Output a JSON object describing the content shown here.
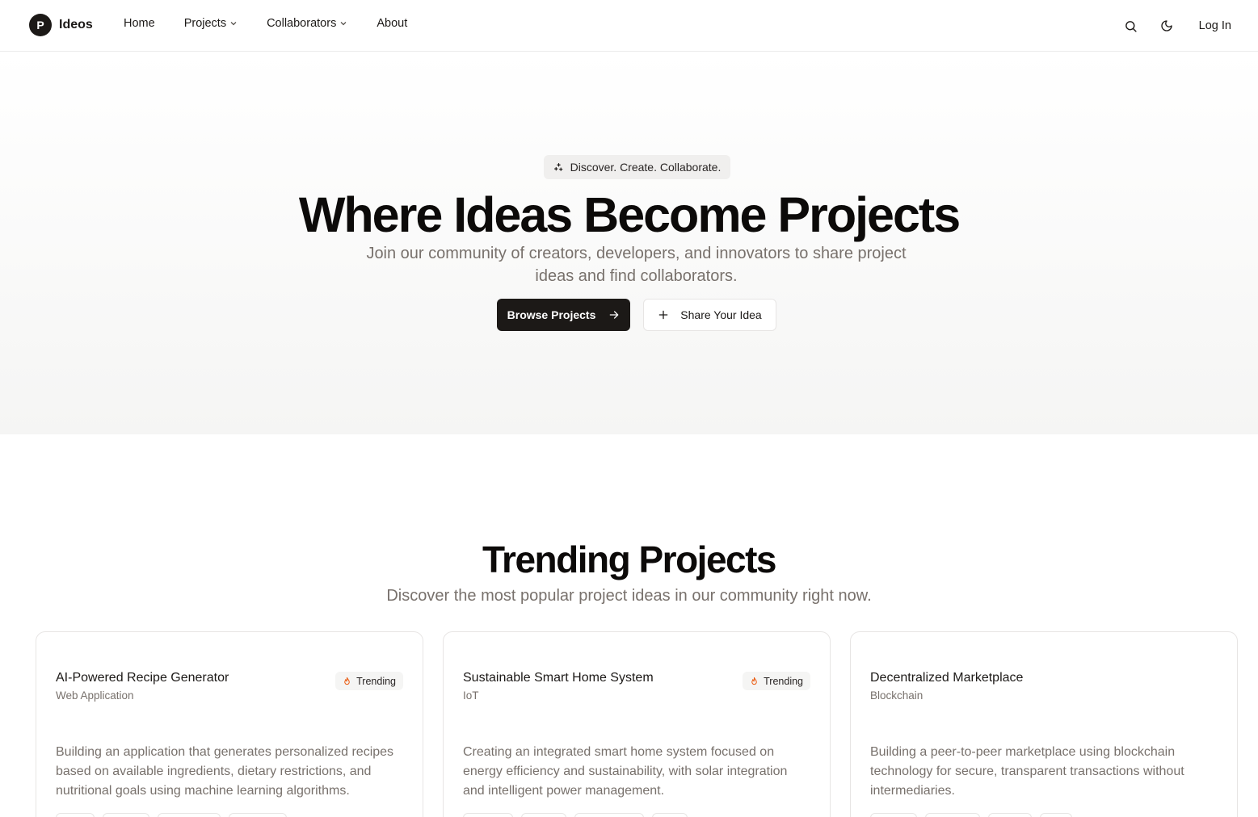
{
  "header": {
    "logo_letter": "P",
    "brand": "Ideos",
    "nav": [
      {
        "label": "Home"
      },
      {
        "label": "Projects"
      },
      {
        "label": "Collaborators"
      },
      {
        "label": "About"
      }
    ],
    "login": "Log In"
  },
  "hero": {
    "pill": "Discover. Create. Collaborate.",
    "title": "Where Ideas Become Projects",
    "subtitle": "Join our community of creators, developers, and innovators to share project ideas and find collaborators.",
    "primary_button": "Browse Projects",
    "secondary_button": "Share Your Idea"
  },
  "trending": {
    "title": "Trending Projects",
    "subtitle": "Discover the most popular project ideas in our community right now.",
    "cards": [
      {
        "title": "AI-Powered Recipe Generator",
        "category": "Web Application",
        "badge": "Trending",
        "description": "Building an application that generates personalized recipes based on available ingredients, dietary restrictions, and nutritional goals using machine learning algorithms."
      },
      {
        "title": "Sustainable Smart Home System",
        "category": "IoT",
        "badge": "Trending",
        "description": "Creating an integrated smart home system focused on energy efficiency and sustainability, with solar integration and intelligent power management."
      },
      {
        "title": "Decentralized Marketplace",
        "category": "Blockchain",
        "badge": "",
        "description": "Building a peer-to-peer marketplace using blockchain technology for secure, transparent transactions without intermediaries."
      }
    ]
  },
  "colors": {
    "primary": "#1c1917",
    "muted_text": "#78716c",
    "trending_accent": "#ea580c"
  }
}
